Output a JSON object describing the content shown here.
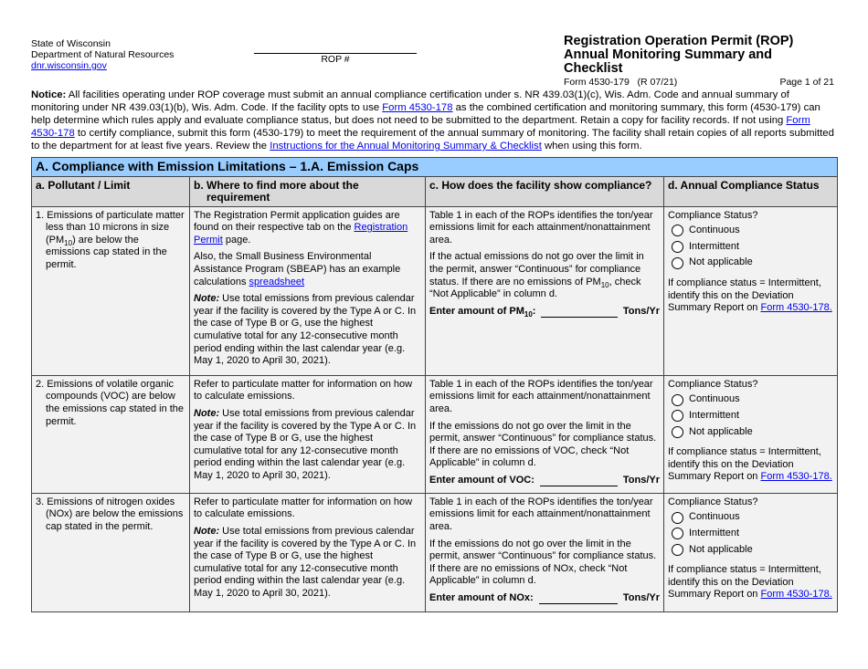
{
  "header": {
    "agency_line1": "State of Wisconsin",
    "agency_line2": "Department of Natural Resources",
    "agency_link": "dnr.wisconsin.gov",
    "rop_label": "ROP #",
    "title_line1": "Registration Operation Permit (ROP)",
    "title_line2": "Annual Monitoring Summary and Checklist",
    "form_number": "Form 4530-179   (R 07/21)",
    "page_info": "Page 1 of 21"
  },
  "notice": {
    "label": "Notice:",
    "text1": "  All facilities operating under ROP coverage must submit an annual compliance certification under s. NR 439.03(1)(c), Wis. Adm. Code and annual summary of monitoring under NR 439.03(1)(b), Wis. Adm. Code.  If the facility opts to use ",
    "link1": "Form 4530-178",
    "text2": " as the combined certification and monitoring summary, this form (4530-179) can help determine which rules apply and evaluate compliance status, but does not need to be submitted to the department. Retain a copy for facility records. If not using ",
    "link2": "Form 4530-178",
    "text3": " to certify compliance, submit this form (4530-179) to meet the requirement of the annual summary of monitoring. The facility shall retain copies of all reports submitted to the department for at least five years. Review the ",
    "link3": "Instructions for the Annual Monitoring Summary & Checklist",
    "text4": " when using this form."
  },
  "table": {
    "section_title": "A.  Compliance with Emission Limitations – 1.A. Emission Caps",
    "columns": [
      "a.  Pollutant / Limit",
      "b.  Where to find more about the requirement",
      "c.  How does the facility show compliance?",
      "d.  Annual Compliance Status"
    ],
    "rows": [
      {
        "pollutant_pre": "1. Emissions of particulate matter less than 10 microns in size (PM",
        "pollutant_sub": "10",
        "pollutant_post": ") are below the emissions cap stated in the permit.",
        "where_p1_pre": "The Registration Permit application guides are found on their respective tab on the ",
        "where_p1_link": "Registration Permit",
        "where_p1_post": " page.",
        "where_p2_pre": "Also, the Small Business Environmental Assistance Program (SBEAP) has an example calculations ",
        "where_p2_link": "spreadsheet",
        "note_label": "Note:",
        "note_text": " Use total emissions from previous calendar year if the facility is covered by the Type A or C. In the case of Type B or G, use the highest cumulative total for any 12-consecutive month period ending within the last calendar year (e.g. May 1, 2020 to April 30, 2021).",
        "how_p1": "Table 1 in each of the ROPs identifies the ton/year emissions limit for each attainment/nonattainment area.",
        "how_p2_pre": "If the actual emissions do not go over the limit in the permit, answer “Continuous” for compliance status. If there are no emissions of PM",
        "how_p2_sub": "10",
        "how_p2_post": ", check “Not Applicable” in column d.",
        "amount_label_pre": "Enter amount of PM",
        "amount_label_sub": "10",
        "amount_label_post": ":",
        "amount_value": "",
        "amount_unit": "Tons/Yr",
        "status_question": "Compliance Status?",
        "options": [
          "Continuous",
          "Intermittent",
          "Not applicable"
        ],
        "status_note_pre": "If compliance status = Intermittent, identify this on the Deviation Summary Report on ",
        "status_note_link": "Form 4530-178."
      },
      {
        "pollutant": "2. Emissions of volatile organic compounds (VOC) are below the emissions cap stated in the permit.",
        "where_p1": "Refer to particulate matter for information on how to calculate emissions.",
        "note_label": "Note:",
        "note_text": " Use total emissions from previous calendar year if the facility is covered by the Type A or C. In the case of Type B or G, use the highest cumulative total for any 12-consecutive month period ending within the last calendar year (e.g. May 1, 2020 to April 30, 2021).",
        "how_p1": "Table 1 in each of the ROPs identifies the ton/year emissions limit for each attainment/nonattainment area.",
        "how_p2": "If the emissions do not go over the limit in the permit, answer “Continuous” for compliance status. If there are no emissions of VOC, check “Not Applicable” in column d.",
        "amount_label": "Enter amount of VOC:",
        "amount_value": "",
        "amount_unit": "Tons/Yr",
        "status_question": "Compliance Status?",
        "options": [
          "Continuous",
          "Intermittent",
          "Not applicable"
        ],
        "status_note_pre": "If compliance status = Intermittent, identify this on the Deviation Summary Report on ",
        "status_note_link": "Form 4530-178."
      },
      {
        "pollutant": "3. Emissions of nitrogen oxides (NOx) are below the emissions cap stated in the permit.",
        "where_p1": "Refer to particulate matter for information on how to calculate emissions.",
        "note_label": "Note:",
        "note_text": " Use total emissions from previous calendar year if the facility is covered by the Type A or C. In the case of Type B or G, use the highest cumulative total for any 12-consecutive month period ending within the last calendar year (e.g. May 1, 2020 to April 30, 2021).",
        "how_p1": "Table 1 in each of the ROPs identifies the ton/year emissions limit for each attainment/nonattainment area.",
        "how_p2": "If the emissions do not go over the limit in the permit, answer “Continuous” for compliance status. If there are no emissions of NOx, check “Not Applicable” in column d.",
        "amount_label": "Enter amount of NOx:",
        "amount_value": "",
        "amount_unit": "Tons/Yr",
        "status_question": "Compliance Status?",
        "options": [
          "Continuous",
          "Intermittent",
          "Not applicable"
        ],
        "status_note_pre": "If compliance status = Intermittent, identify this on the Deviation Summary Report on ",
        "status_note_link": "Form 4530-178."
      }
    ]
  }
}
